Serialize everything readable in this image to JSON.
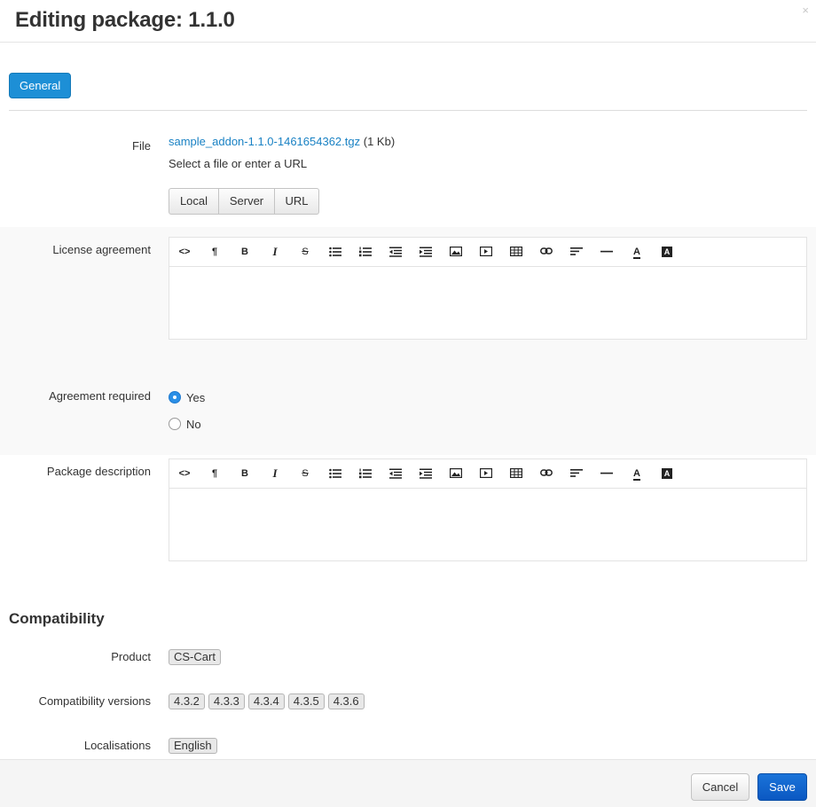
{
  "dialog": {
    "title": "Editing package: 1.1.0",
    "close_glyph": "×"
  },
  "tabs": [
    {
      "label": "General",
      "active": true
    }
  ],
  "file": {
    "label": "File",
    "filename": "sample_addon-1.1.0-1461654362.tgz",
    "size": "(1 Kb)",
    "hint": "Select a file or enter a URL",
    "sources": [
      "Local",
      "Server",
      "URL"
    ]
  },
  "license": {
    "label": "License agreement",
    "content": ""
  },
  "editor_toolbar": {
    "buttons": [
      "html-code-icon",
      "paragraph-icon",
      "bold-icon",
      "italic-icon",
      "strikethrough-icon",
      "bullet-list-icon",
      "numbered-list-icon",
      "outdent-icon",
      "indent-icon",
      "image-icon",
      "video-icon",
      "table-icon",
      "link-icon",
      "align-icon",
      "horizontal-rule-icon",
      "font-color-icon",
      "background-color-icon"
    ],
    "glyphs": {
      "code": "<>",
      "paragraph": "¶",
      "bold": "B",
      "italic": "I",
      "strike": "S",
      "font_color": "A",
      "bg_color": "A"
    }
  },
  "agreement_required": {
    "label": "Agreement required",
    "options": [
      {
        "label": "Yes",
        "checked": true
      },
      {
        "label": "No",
        "checked": false
      }
    ]
  },
  "package_description": {
    "label": "Package description",
    "content": ""
  },
  "compatibility": {
    "title": "Compatibility",
    "product_label": "Product",
    "products": [
      "CS-Cart"
    ],
    "versions_label": "Compatibility versions",
    "versions": [
      "4.3.2",
      "4.3.3",
      "4.3.4",
      "4.3.5",
      "4.3.6"
    ],
    "localisations_label": "Localisations",
    "localisations": [
      "English"
    ]
  },
  "footer": {
    "cancel_label": "Cancel",
    "save_label": "Save"
  },
  "colors": {
    "primary": "#1d8fd6",
    "save": "#0b58c2",
    "link": "#1a82c4"
  }
}
